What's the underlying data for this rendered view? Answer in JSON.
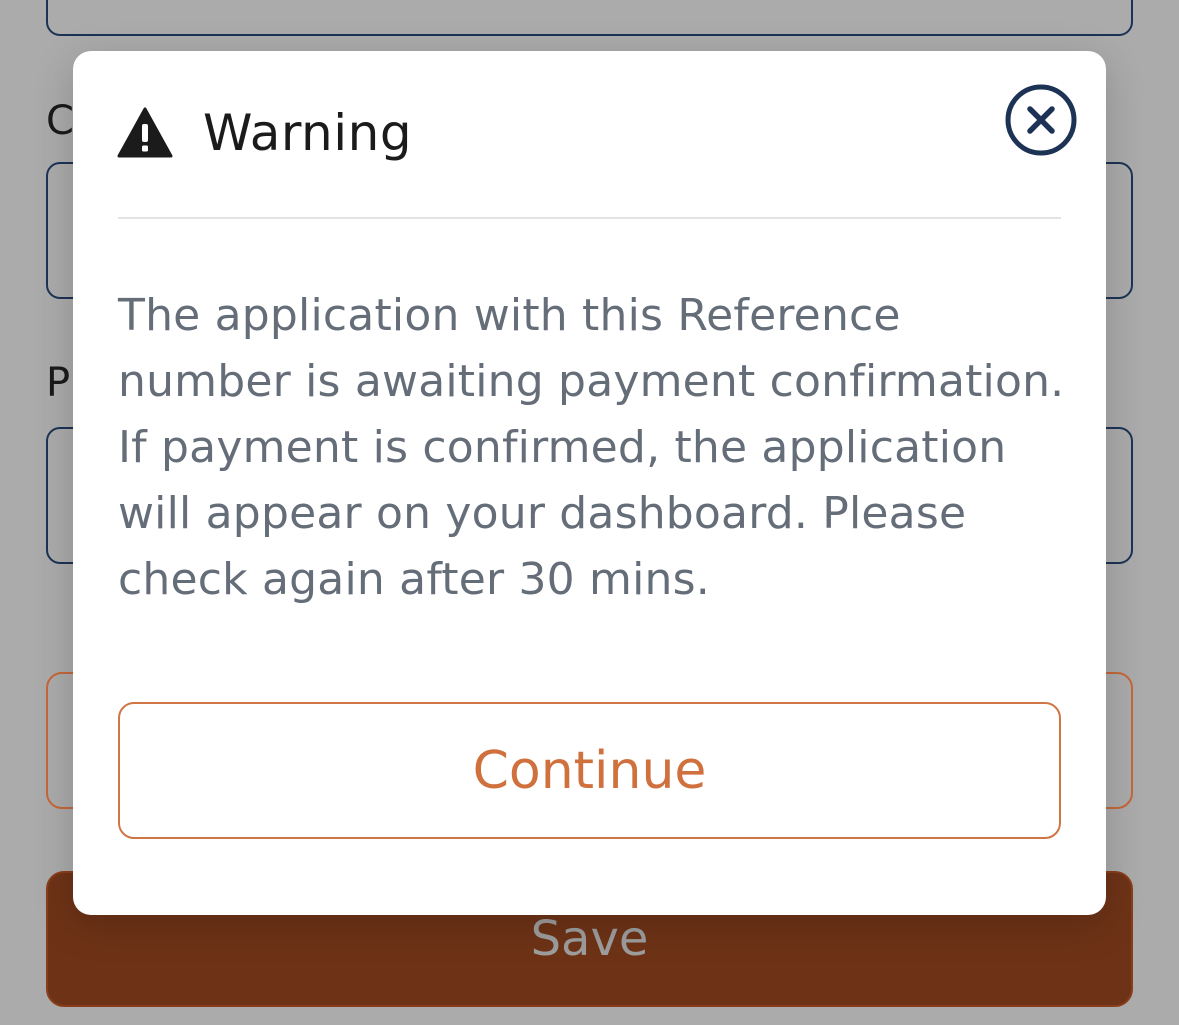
{
  "background_form": {
    "label_1_visible": "C",
    "label_2_visible": "P",
    "save_label": "Save"
  },
  "modal": {
    "icon": "warning-triangle-icon",
    "title": "Warning",
    "close_icon": "close-circle-icon",
    "message": "The application with this Reference number is awaiting payment confirmation. If payment is confirmed, the application will appear on your dashboard. Please check again after 30 mins.",
    "continue_label": "Continue"
  },
  "colors": {
    "overlay": "#ababab",
    "accent": "#d0703d",
    "save_button": "#6e3317",
    "field_border": "#1c3356",
    "body_text": "#646d78"
  }
}
